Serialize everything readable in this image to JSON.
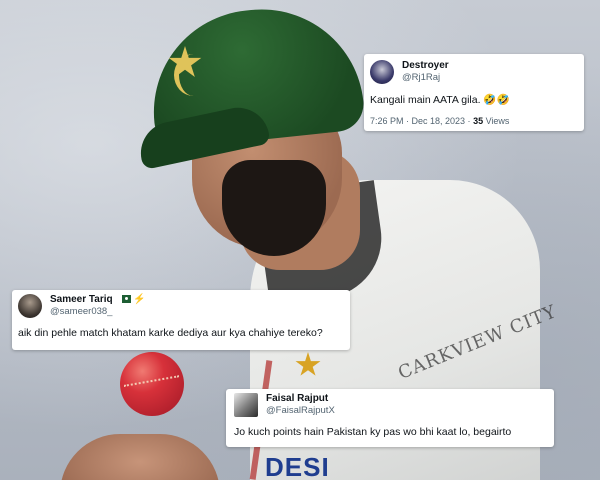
{
  "tweets": [
    {
      "name": "Destroyer",
      "handle": "@Rj1Raj",
      "text": "Kangali main AATA gila. 🤣🤣",
      "time": "7:26 PM · Dec 18, 2023 · ",
      "views_count": "35",
      "views_label": " Views"
    },
    {
      "name": "Sameer Tariq",
      "handle": "@sameer038_",
      "text": "aik din pehle match khatam karke dediya aur kya chahiye tereko?",
      "badges": [
        "pakistan-flag-icon",
        "lightning-icon"
      ]
    },
    {
      "name": "Faisal Rajput",
      "handle": "@FaisalRajputX",
      "text": "Jo kuch points hain Pakistan ky pas wo bhi kaat lo, begairto"
    }
  ],
  "photo": {
    "shirt_text": "CARKVIEW CITY",
    "shirt_logo": "DESI"
  },
  "colors": {
    "cap_green": "#1c4a22",
    "ball_red": "#d7313a",
    "text_primary": "#0f1419",
    "text_secondary": "#536471"
  }
}
